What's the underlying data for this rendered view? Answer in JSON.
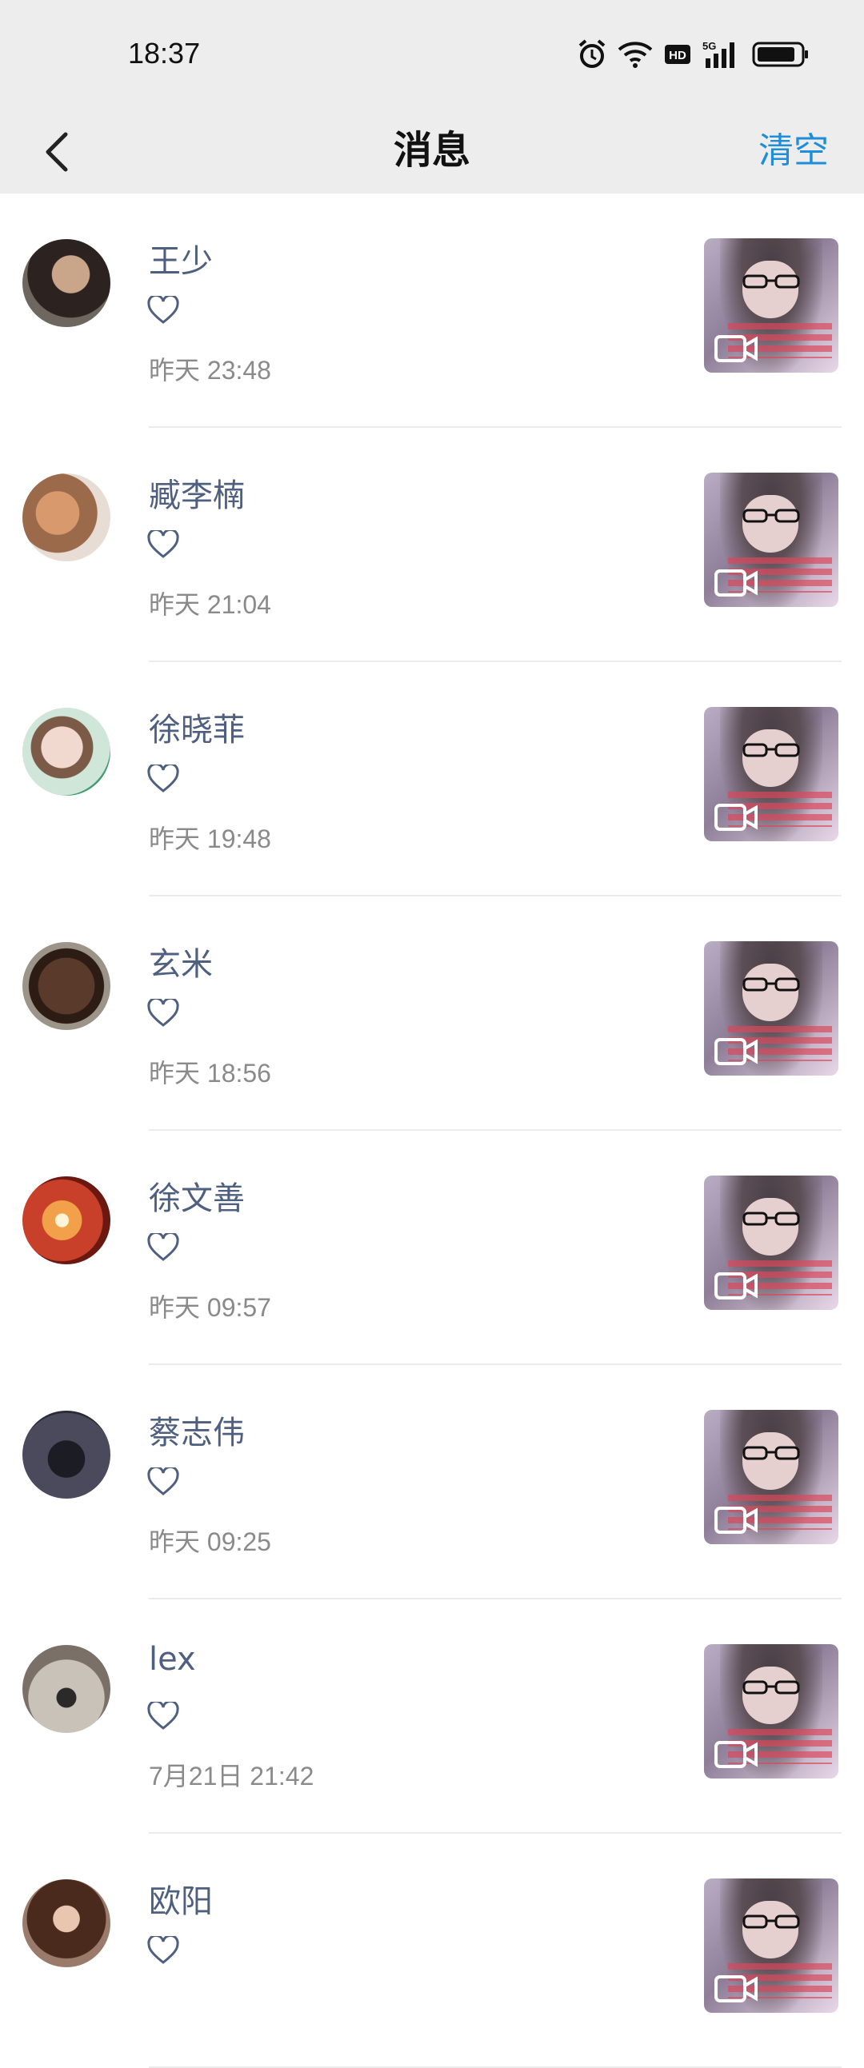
{
  "status_bar": {
    "time": "18:37",
    "icons": [
      "alarm-icon",
      "wifi-icon",
      "hd-icon",
      "signal-5g-icon",
      "battery-icon"
    ],
    "hd_label": "HD",
    "network_label": "5G"
  },
  "header": {
    "back_icon": "chevron-left-icon",
    "title": "消息",
    "clear_label": "清空"
  },
  "colors": {
    "accent": "#1f8ed8",
    "name": "#4f5f7f",
    "time": "#8a8a8a",
    "header_bg": "#ededed"
  },
  "messages": [
    {
      "name": "王少",
      "type": "like",
      "icon": "heart-icon",
      "time": "昨天 23:48",
      "thumbnail": "video-thumbnail"
    },
    {
      "name": "臧李楠",
      "type": "like",
      "icon": "heart-icon",
      "time": "昨天 21:04",
      "thumbnail": "video-thumbnail"
    },
    {
      "name": "徐晓菲",
      "type": "like",
      "icon": "heart-icon",
      "time": "昨天 19:48",
      "thumbnail": "video-thumbnail"
    },
    {
      "name": "玄米",
      "type": "like",
      "icon": "heart-icon",
      "time": "昨天 18:56",
      "thumbnail": "video-thumbnail"
    },
    {
      "name": "徐文善",
      "type": "like",
      "icon": "heart-icon",
      "time": "昨天 09:57",
      "thumbnail": "video-thumbnail"
    },
    {
      "name": "蔡志伟",
      "type": "like",
      "icon": "heart-icon",
      "time": "昨天 09:25",
      "thumbnail": "video-thumbnail"
    },
    {
      "name": "lex",
      "type": "like",
      "icon": "heart-icon",
      "time": "7月21日 21:42",
      "thumbnail": "video-thumbnail"
    },
    {
      "name": "欧阳",
      "type": "like",
      "icon": "heart-icon",
      "time": "",
      "thumbnail": "video-thumbnail"
    }
  ]
}
